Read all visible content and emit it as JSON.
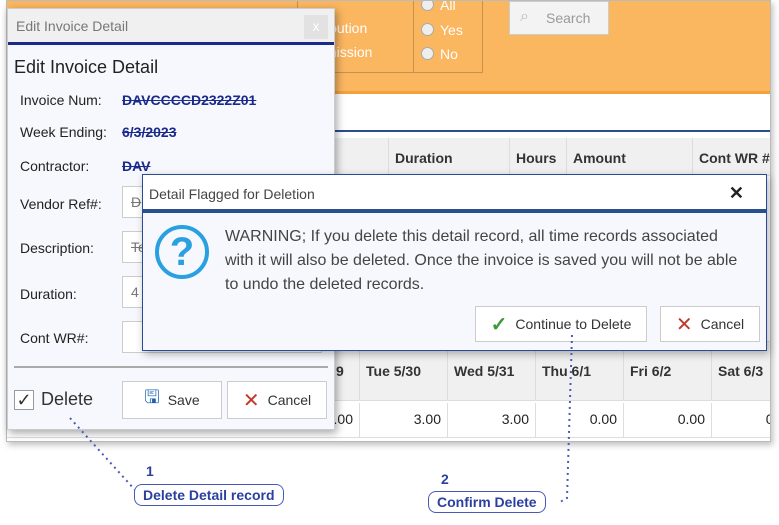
{
  "filters": {
    "partial_labels": [
      "ibution",
      "smission"
    ],
    "radios": [
      {
        "label": "All",
        "checked": true
      },
      {
        "label": "Yes",
        "checked": false
      },
      {
        "label": "No",
        "checked": false
      }
    ],
    "search_label": "Search"
  },
  "grid_top": {
    "headers": [
      "Duration",
      "Hours",
      "Amount",
      "Cont WR #"
    ]
  },
  "grid_bottom": {
    "headers": [
      "9",
      "Tue 5/30",
      "Wed 5/31",
      "Thu 6/1",
      "Fri 6/2",
      "Sat 6/3"
    ],
    "row": [
      ".00",
      "3.00",
      "3.00",
      "0.00",
      "0.00",
      "0.00"
    ]
  },
  "edit_dialog": {
    "window_title": "Edit Invoice Detail",
    "heading": "Edit Invoice Detail",
    "close": "x",
    "fields": {
      "invoice_num_label": "Invoice Num:",
      "invoice_num": "DAVCCCCD2322Z01",
      "week_ending_label": "Week Ending:",
      "week_ending": "6/3/2023",
      "contractor_label": "Contractor:",
      "contractor": "DAV",
      "vendor_ref_label": "Vendor Ref#:",
      "vendor_ref": "D",
      "description_label": "Description:",
      "description": "Te",
      "duration_label": "Duration:",
      "duration": "4",
      "cont_wr_label": "Cont WR#:",
      "cont_wr": ""
    },
    "delete_label": "Delete",
    "delete_checked": true,
    "save_label": "Save",
    "cancel_label": "Cancel"
  },
  "warning_dialog": {
    "title": "Detail Flagged for Deletion",
    "close": "✕",
    "message": "WARNING;  If you delete this detail record, all time records associated with it will also be deleted.  Once the invoice is saved you will not be able to undo the deleted records.",
    "continue_label": "Continue to Delete",
    "cancel_label": "Cancel"
  },
  "callouts": [
    {
      "number": "1",
      "text": "Delete Detail record"
    },
    {
      "number": "2",
      "text": "Confirm Delete"
    }
  ],
  "colors": {
    "header_orange": "#fbb660",
    "accent_blue": "#1a2a8a",
    "check_green": "#3a9a3a",
    "cancel_red": "#c0392b",
    "info_blue": "#29a0e0"
  }
}
